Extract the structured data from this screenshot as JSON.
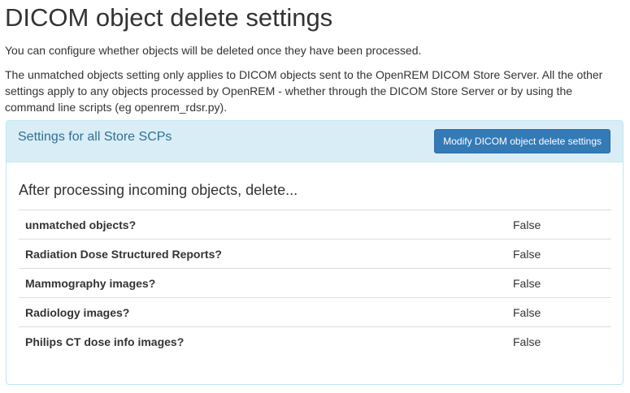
{
  "page": {
    "title": "DICOM object delete settings",
    "intro": "You can configure whether objects will be deleted once they have been processed.",
    "intro2": "The unmatched objects setting only applies to DICOM objects sent to the OpenREM DICOM Store Server. All the other settings apply to any objects processed by OpenREM - whether through the DICOM Store Server or by using the command line scripts (eg openrem_rdsr.py)."
  },
  "panel": {
    "title": "Settings for all Store SCPs",
    "button_label": "Modify DICOM object delete settings",
    "section_heading": "After processing incoming objects, delete...",
    "rows": [
      {
        "label": "unmatched objects?",
        "value": "False"
      },
      {
        "label": "Radiation Dose Structured Reports?",
        "value": "False"
      },
      {
        "label": "Mammography images?",
        "value": "False"
      },
      {
        "label": "Radiology images?",
        "value": "False"
      },
      {
        "label": "Philips CT dose info images?",
        "value": "False"
      }
    ]
  },
  "colors": {
    "panel_heading_bg": "#d9edf7",
    "panel_border": "#bce8f1",
    "panel_title": "#31708f",
    "primary_button": "#337ab7"
  }
}
